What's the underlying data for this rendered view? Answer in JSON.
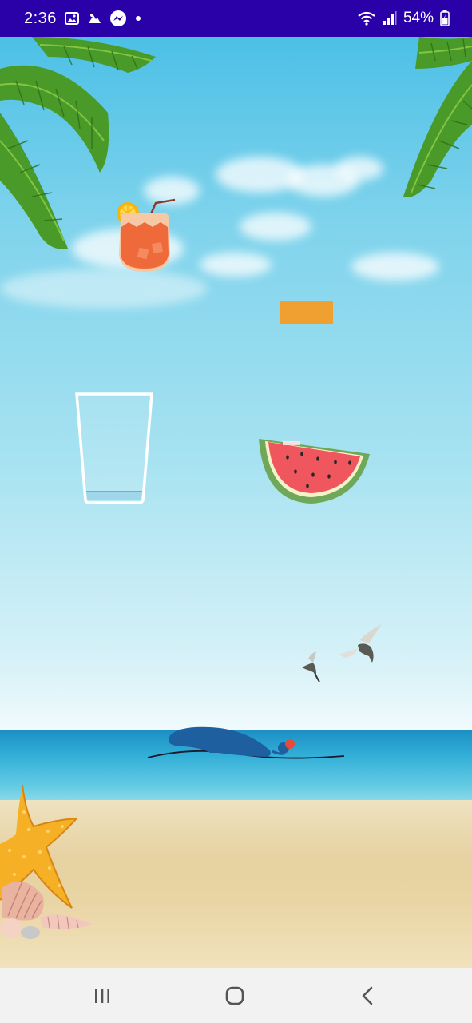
{
  "status_bar": {
    "time": "2:36",
    "battery": "54%",
    "left_icons": [
      "image-icon",
      "notification-icon",
      "messenger-icon",
      "dot-icon"
    ],
    "right_icons": [
      "wifi-icon",
      "signal-icon",
      "battery-icon"
    ],
    "background_color": "#2a00a8"
  },
  "scene": {
    "theme": "beach",
    "items": [
      {
        "name": "cocktail-drink",
        "icon": "cocktail-icon"
      },
      {
        "name": "orange-block",
        "icon": "rectangle-icon",
        "color": "#f0a030"
      },
      {
        "name": "empty-glass",
        "icon": "glass-icon"
      },
      {
        "name": "watermelon-slice",
        "icon": "watermelon-icon"
      },
      {
        "name": "swimmer",
        "icon": "swimmer-icon"
      },
      {
        "name": "seagulls",
        "icon": "seagull-icon"
      }
    ],
    "glass_fill_fraction": 0.05
  },
  "nav_bar": {
    "buttons": [
      "recent-apps",
      "home",
      "back"
    ],
    "background_color": "#f2f2f2"
  }
}
